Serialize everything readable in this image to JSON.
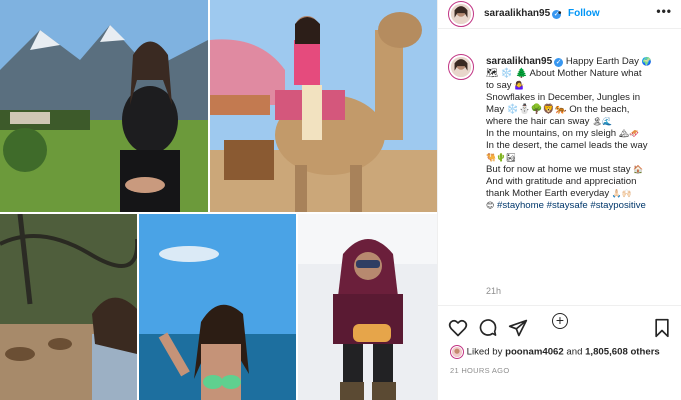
{
  "post": {
    "username": "saraalikhan95",
    "follow_label": "Follow",
    "more_label": "•••",
    "separator": "•",
    "verified_mark": "✓",
    "caption_lines": [
      {
        "text": "Happy Earth Day",
        "emoji": "🌍"
      },
      {
        "text": "🗺 ❄️ 🌲 About Mother Nature what",
        "emoji": ""
      },
      {
        "text": "to say",
        "emoji": "🤷‍♀️"
      },
      {
        "text": "Snowflakes in December, Jungles in",
        "emoji": ""
      },
      {
        "text": "May",
        "emoji": "❄️⛄🌳🦁🐅 On the beach,"
      },
      {
        "text": "where the hair can sway",
        "emoji": "🏝🌊"
      },
      {
        "text": "In the mountains, on my sleigh",
        "emoji": "🏔🛷"
      },
      {
        "text": "In the desert, the camel leads the way",
        "emoji": ""
      },
      {
        "text": "",
        "emoji": "🐫🌵🏜"
      },
      {
        "text": "But for now at home we must stay",
        "emoji": "🏠"
      },
      {
        "text": "And with gratitude and appreciation",
        "emoji": ""
      },
      {
        "text": "thank Mother Earth everyday",
        "emoji": "🙏🏻🙌🏻"
      }
    ],
    "hashtags": [
      "#stayhome",
      "#staysafe",
      "#staypositive"
    ],
    "hashtag_prefix_emoji": "😊",
    "comment_time": "21h",
    "load_more_symbol": "+",
    "likes": {
      "liked_by_label": "Liked by",
      "liker": "poonam4062",
      "and_label": "and",
      "others_count": "1,805,608 others"
    },
    "time_ago": "21 HOURS AGO"
  },
  "icons": {
    "verified": "verified-badge-icon",
    "like": "heart-icon",
    "comment": "comment-bubble-icon",
    "share": "paper-plane-icon",
    "save": "bookmark-icon",
    "load_more": "plus-circle-icon"
  },
  "colors": {
    "follow": "#0095f6",
    "verified": "#3897f0",
    "hashtag": "#00376b",
    "muted": "#8e8e8e",
    "text": "#262626"
  }
}
